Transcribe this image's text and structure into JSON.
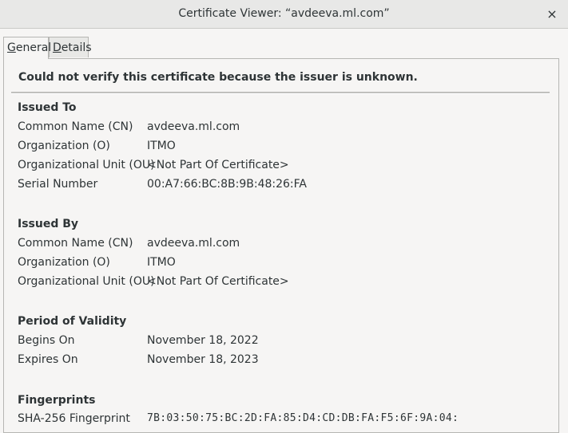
{
  "window": {
    "title": "Certificate Viewer: “avdeeva.ml.com”",
    "close_symbol": "×"
  },
  "tabs": [
    {
      "label_underlined": "G",
      "label_rest": "eneral"
    },
    {
      "label_underlined": "D",
      "label_rest": "etails"
    }
  ],
  "warning": "Could not verify this certificate because the issuer is unknown.",
  "issued_to": {
    "heading": "Issued To",
    "rows": [
      {
        "label": "Common Name (CN)",
        "value": "avdeeva.ml.com"
      },
      {
        "label": "Organization (O)",
        "value": "ITMO"
      },
      {
        "label": "Organizational Unit (OU)",
        "value": "<Not Part Of Certificate>"
      },
      {
        "label": "Serial Number",
        "value": "00:A7:66:BC:8B:9B:48:26:FA"
      }
    ]
  },
  "issued_by": {
    "heading": "Issued By",
    "rows": [
      {
        "label": "Common Name (CN)",
        "value": "avdeeva.ml.com"
      },
      {
        "label": "Organization (O)",
        "value": "ITMO"
      },
      {
        "label": "Organizational Unit (OU)",
        "value": "<Not Part Of Certificate>"
      }
    ]
  },
  "validity": {
    "heading": "Period of Validity",
    "rows": [
      {
        "label": "Begins On",
        "value": "November 18, 2022"
      },
      {
        "label": "Expires On",
        "value": "November 18, 2023"
      }
    ]
  },
  "fingerprints": {
    "heading": "Fingerprints",
    "rows": [
      {
        "label": "SHA-256 Fingerprint",
        "value": "7B:03:50:75:BC:2D:FA:85:D4:CD:DB:FA:F5:6F:9A:04:"
      }
    ]
  }
}
